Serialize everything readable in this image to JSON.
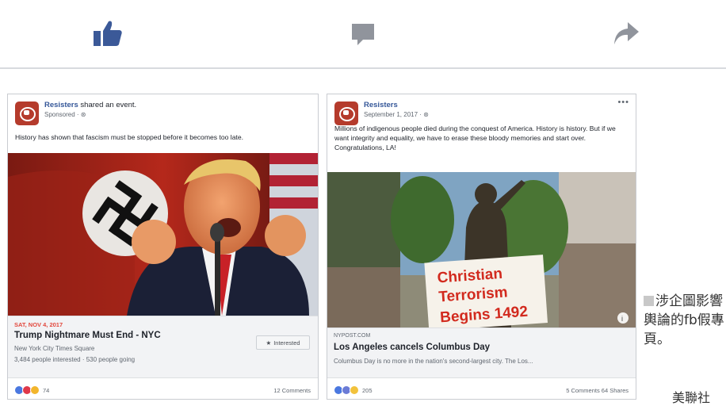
{
  "toolbar": {
    "like_icon": "thumbs-up-icon",
    "comment_icon": "speech-bubble-icon",
    "share_icon": "share-arrow-icon",
    "accent": "#3b5998",
    "icon_gray": "#90949c"
  },
  "post1": {
    "page_name": "Resisters",
    "action": " shared an event.",
    "sub": "Sponsored · ⊛",
    "text": "History has shown that fascism must be stopped before it becomes too late.",
    "event_date": "SAT, NOV 4, 2017",
    "event_title": "Trump Nightmare Must End - NYC",
    "event_location": "New York City Times Square",
    "event_stats": "3,484 people interested · 530 people going",
    "interested_label": "Interested",
    "reaction_count": "74",
    "comments": "12 Comments"
  },
  "post2": {
    "page_name": "Resisters",
    "sub": "September 1, 2017 · ⊛",
    "text": "Millions of indigenous people died during the conquest of America. History is history. But if we want integrity and equality, we have to erase these bloody memories and start over. Congratulations, LA!",
    "more": "•••",
    "sign_line1": "Christian",
    "sign_line2": "Terrorism",
    "sign_line3": "Begins 1492",
    "domain": "NYPOST.COM",
    "link_title": "Los Angeles cancels Columbus Day",
    "link_desc": "Columbus Day is no more in the nation's second-largest city. The Los...",
    "reaction_count": "205",
    "comments": "5 Comments  64 Shares"
  },
  "caption": {
    "text": "涉企圖影響輿論的fb假專頁。",
    "credit": "美聯社"
  }
}
